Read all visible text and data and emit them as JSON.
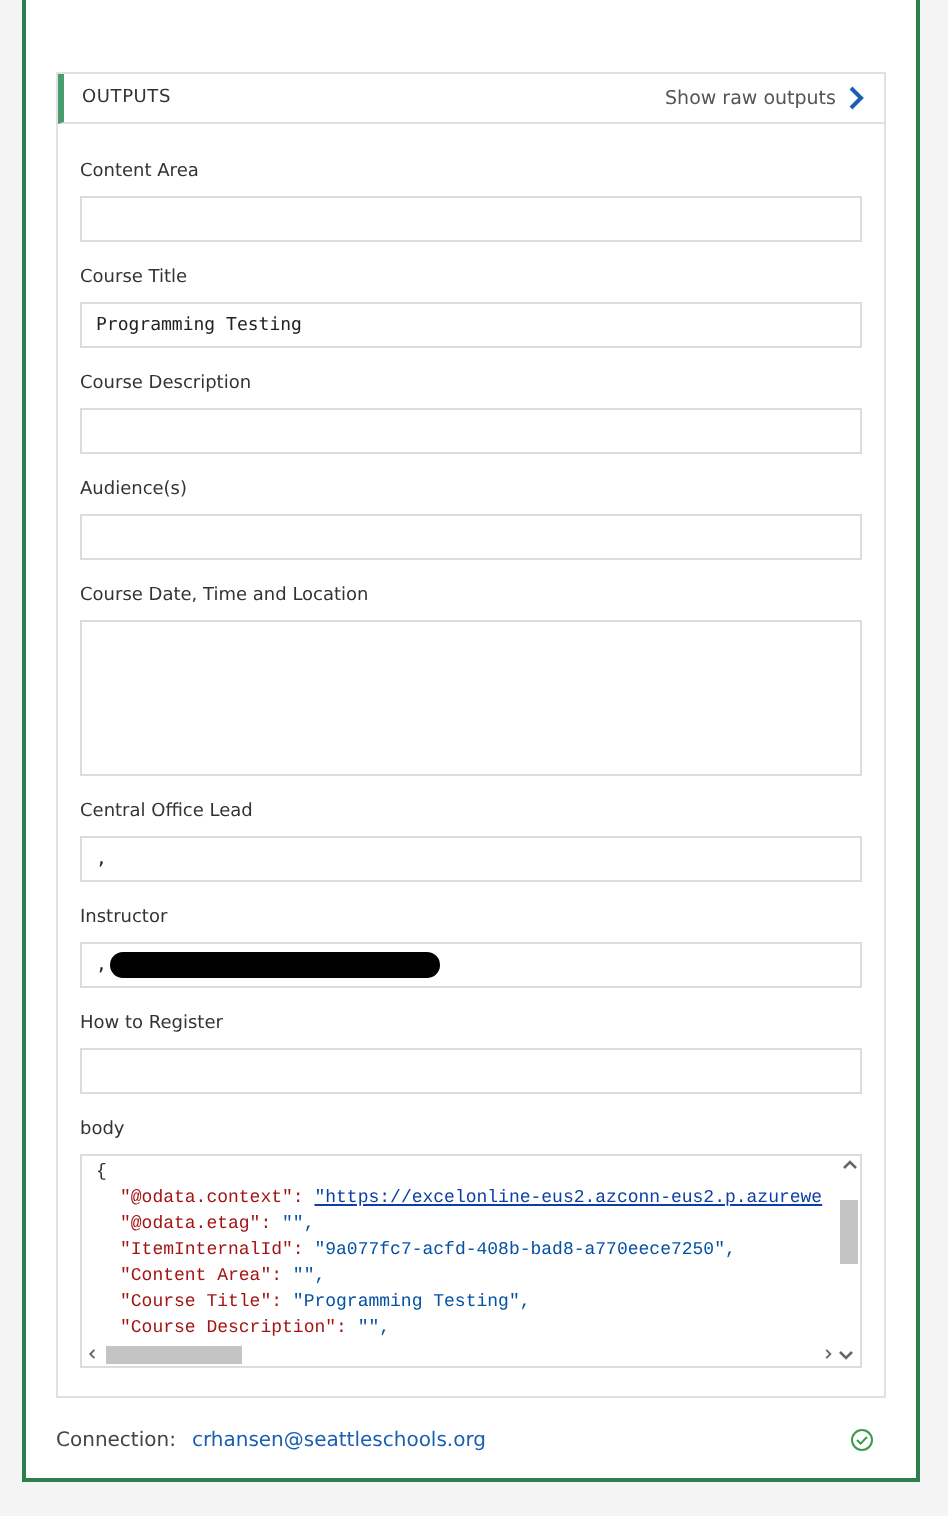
{
  "outputs": {
    "title": "OUTPUTS",
    "raw_link": "Show raw outputs"
  },
  "fields": [
    {
      "kind": "input",
      "label": "Content Area"
    },
    {
      "kind": "input",
      "label": "Course Title",
      "value": "Programming Testing"
    },
    {
      "kind": "input",
      "label": "Course Description"
    },
    {
      "kind": "input",
      "label": "Audience(s)"
    },
    {
      "kind": "textarea",
      "label": "Course Date, Time and Location"
    },
    {
      "kind": "input",
      "label": "Central Office Lead",
      "value": ","
    },
    {
      "kind": "input",
      "label": "Instructor",
      "value": ",",
      "redacted": true
    },
    {
      "kind": "input",
      "label": "How to Register"
    }
  ],
  "body": {
    "label": "body",
    "lines": [
      {
        "kind": "brace",
        "text": "{"
      },
      {
        "kind": "entry",
        "key": "\"@odata.context\":",
        "value": "\"https://excelonline-eus2.azconn-eus2.p.azurewe",
        "link": true
      },
      {
        "kind": "entry",
        "key": "\"@odata.etag\":",
        "value": "\"\",",
        "link": false
      },
      {
        "kind": "entry",
        "key": "\"ItemInternalId\":",
        "value": "\"9a077fc7-acfd-408b-bad8-a770eece7250\",",
        "link": false
      },
      {
        "kind": "entry",
        "key": "\"Content Area\":",
        "value": "\"\",",
        "link": false
      },
      {
        "kind": "entry",
        "key": "\"Course Title\":",
        "value": "\"Programming Testing\",",
        "link": false
      },
      {
        "kind": "entry",
        "key": "\"Course Description\":",
        "value": "\"\",",
        "link": false
      }
    ]
  },
  "connection": {
    "label": "Connection:",
    "account": "crhansen@seattleschools.org",
    "connected": true
  }
}
